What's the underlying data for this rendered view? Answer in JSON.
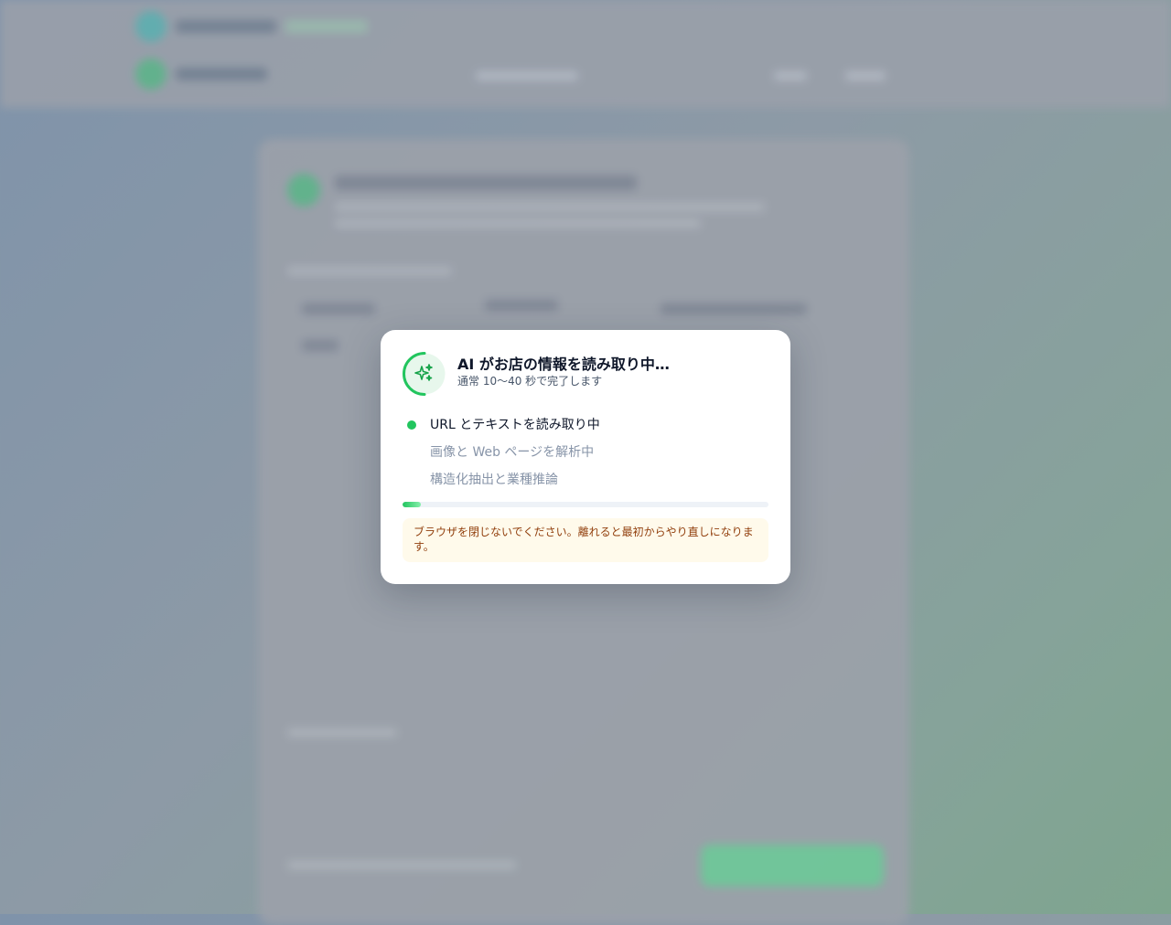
{
  "modal": {
    "title": "AI がお店の情報を読み取り中…",
    "subtitle": "通常 10〜40 秒で完了します",
    "steps": [
      {
        "label": "URL とテキストを読み取り中",
        "status": "active"
      },
      {
        "label": "画像と Web ページを解析中",
        "status": "pending"
      },
      {
        "label": "構造化抽出と業種推論",
        "status": "pending"
      }
    ],
    "progress": 0.05,
    "warning": "ブラウザを閉じないでください。離れると最初からやり直しになります。",
    "icon": "sparkles-icon"
  },
  "colors": {
    "accent": "#22c55e",
    "title": "#0f172a",
    "warning_bg": "#fffaeb",
    "warning_text": "#92400e"
  }
}
